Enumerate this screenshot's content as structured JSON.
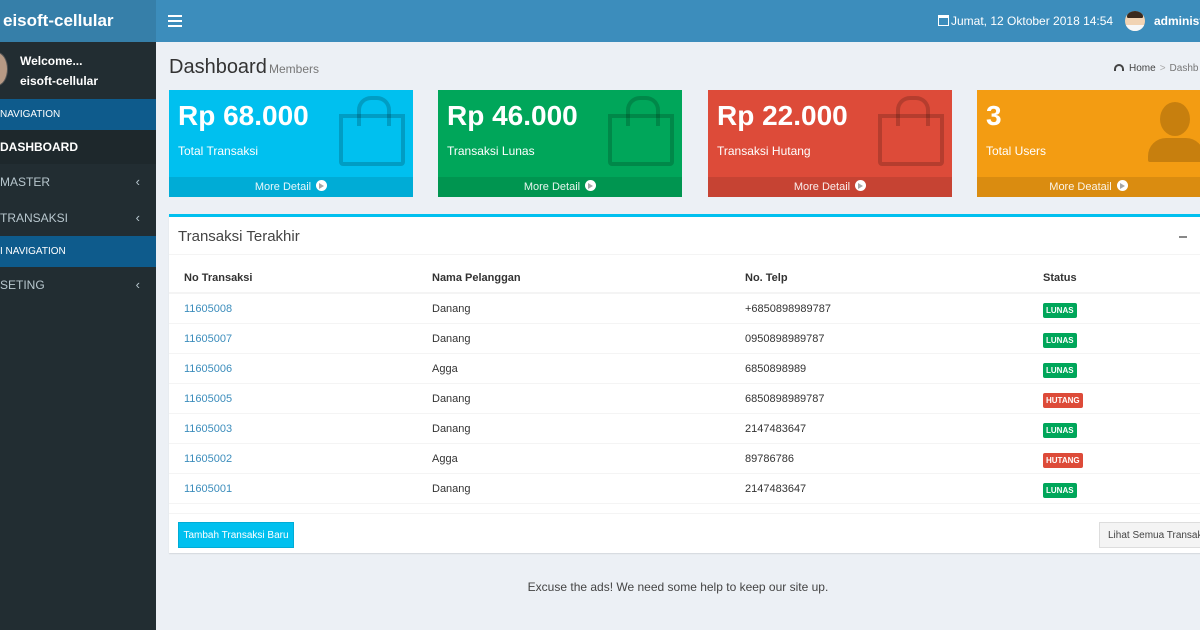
{
  "header": {
    "brand": "eisoft-cellular",
    "date": "Jumat, 12 Oktober 2018 14:54",
    "user": "administ"
  },
  "sidebar": {
    "welcome": "Welcome...",
    "username": "eisoft-cellular",
    "header1": "NAVIGATION",
    "items": [
      {
        "label": "DASHBOARD"
      },
      {
        "label": "MASTER"
      },
      {
        "label": "TRANSAKSI"
      }
    ],
    "header2": "I NAVIGATION",
    "items2": [
      {
        "label": "SETING"
      }
    ],
    "chevron": "‹"
  },
  "page": {
    "title": "Dashboard",
    "subtitle": "Members",
    "breadcrumb_home": "Home",
    "breadcrumb_current": "Dashb"
  },
  "boxes": [
    {
      "amount": "Rp 68.000",
      "label": "Total Transaksi",
      "footer": "More Detail",
      "color": "#00c0ef"
    },
    {
      "amount": "Rp 46.000",
      "label": "Transaksi Lunas",
      "footer": "More Detail",
      "color": "#00a65a"
    },
    {
      "amount": "Rp 22.000",
      "label": "Transaksi Hutang",
      "footer": "More Detail",
      "color": "#dd4b39"
    },
    {
      "amount": "3",
      "label": "Total Users",
      "footer": "More Deatail",
      "color": "#f39c12"
    }
  ],
  "transactions": {
    "title": "Transaksi Terakhir",
    "columns": [
      "No Transaksi",
      "Nama Pelanggan",
      "No. Telp",
      "Status"
    ],
    "rows": [
      {
        "no": "11605008",
        "nama": "Danang",
        "telp": "+6850898989787",
        "status": "LUNAS"
      },
      {
        "no": "11605007",
        "nama": "Danang",
        "telp": "0950898989787",
        "status": "LUNAS"
      },
      {
        "no": "11605006",
        "nama": "Agga",
        "telp": "6850898989",
        "status": "LUNAS"
      },
      {
        "no": "11605005",
        "nama": "Danang",
        "telp": "6850898989787",
        "status": "HUTANG"
      },
      {
        "no": "11605003",
        "nama": "Danang",
        "telp": "2147483647",
        "status": "LUNAS"
      },
      {
        "no": "11605002",
        "nama": "Agga",
        "telp": "89786786",
        "status": "HUTANG"
      },
      {
        "no": "11605001",
        "nama": "Danang",
        "telp": "2147483647",
        "status": "LUNAS"
      }
    ],
    "btn_new": "Tambah Transaksi Baru",
    "btn_all": "Lihat Semua Transaksi"
  },
  "footer_note": "Excuse the ads! We need some help to keep our site up."
}
